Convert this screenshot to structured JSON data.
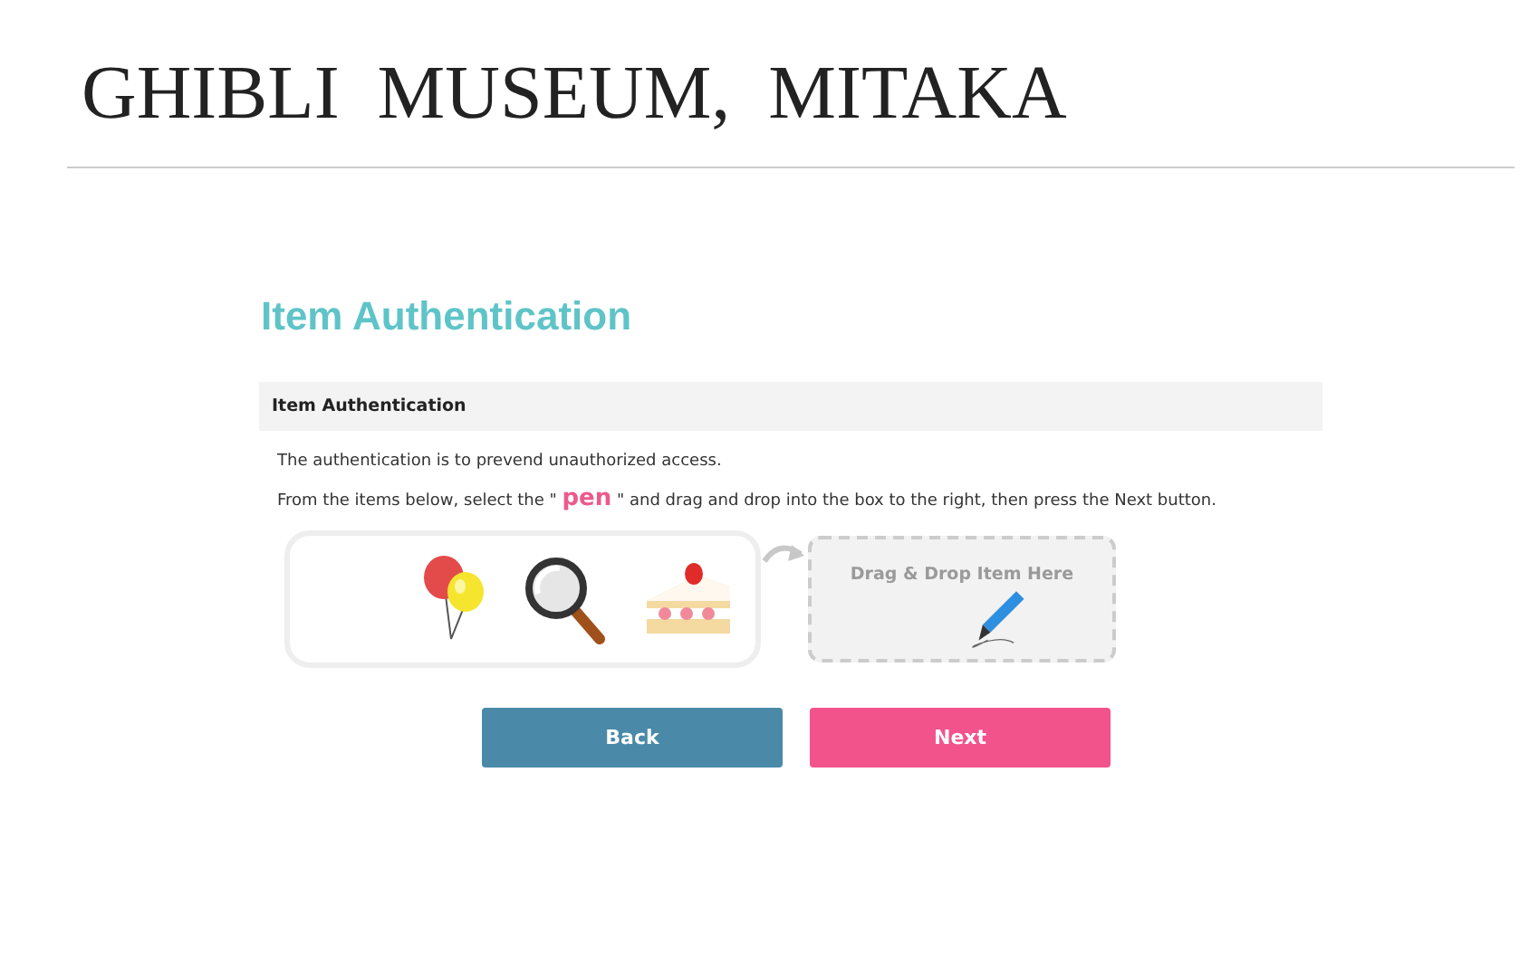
{
  "site_title": "GHIBLI  MUSEUM,  MITAKA",
  "page_heading": "Item Authentication",
  "section": {
    "title": "Item Authentication",
    "lines": [
      "The authentication is to prevend unauthorized access.",
      "From the items below, select the \" **pen** \" and drag and drop into the box to the right, then press the Next button."
    ]
  },
  "items": [
    {
      "kind": "balloons"
    },
    {
      "kind": "magnifier"
    },
    {
      "kind": "cake"
    }
  ],
  "drop_zone": {
    "label": "Drag & Drop Item Here",
    "dropped": {
      "kind": "pen"
    }
  },
  "buttons": [
    {
      "label": "Back",
      "kind": "back"
    },
    {
      "label": "Next",
      "kind": "next"
    }
  ]
}
